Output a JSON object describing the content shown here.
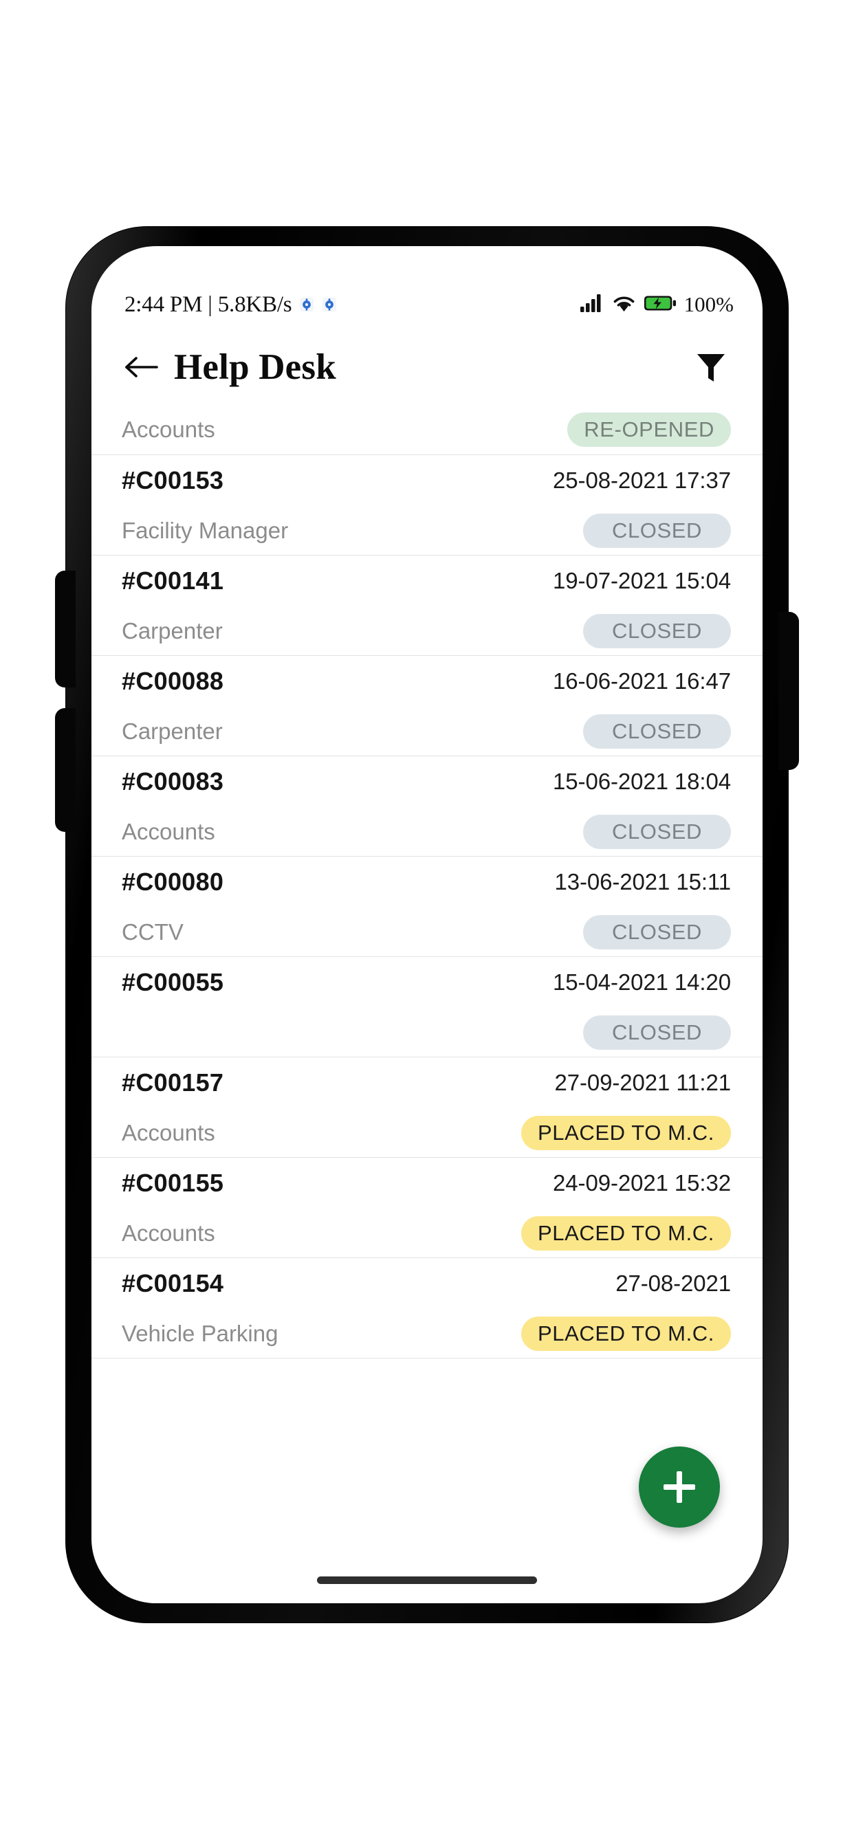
{
  "status_bar": {
    "time_and_speed": "2:44 PM | 5.8KB/s",
    "mini_icons": [
      "settings-gear-icon",
      "settings-gear-icon"
    ],
    "signal_icon": "signal-bars-icon",
    "wifi_icon": "wifi-icon",
    "battery_icon": "battery-charging-icon",
    "battery_percent": "100%"
  },
  "app_bar": {
    "back_icon": "arrow-left-icon",
    "title": "Help Desk",
    "filter_icon": "filter-funnel-icon"
  },
  "colors": {
    "fab_green": "#167d3b",
    "badge_closed_bg": "#dde4e9",
    "badge_closed_text": "#7b8288",
    "badge_reopened_bg": "#d5ead9",
    "badge_reopened_text": "#76817a",
    "badge_placed_bg": "#fce68a",
    "badge_placed_text": "#19191a"
  },
  "fab": {
    "icon": "plus-icon",
    "label": "+"
  },
  "tickets": [
    {
      "id": "",
      "date": "",
      "dept": "Accounts",
      "status": "RE-OPENED",
      "status_kind": "reopened",
      "partial": true
    },
    {
      "id": "#C00153",
      "date": "25-08-2021 17:37",
      "dept": "Facility Manager",
      "status": "CLOSED",
      "status_kind": "closed",
      "partial": false
    },
    {
      "id": "#C00141",
      "date": "19-07-2021 15:04",
      "dept": "Carpenter",
      "status": "CLOSED",
      "status_kind": "closed",
      "partial": false
    },
    {
      "id": "#C00088",
      "date": "16-06-2021 16:47",
      "dept": "Carpenter",
      "status": "CLOSED",
      "status_kind": "closed",
      "partial": false
    },
    {
      "id": "#C00083",
      "date": "15-06-2021 18:04",
      "dept": "Accounts",
      "status": "CLOSED",
      "status_kind": "closed",
      "partial": false
    },
    {
      "id": "#C00080",
      "date": "13-06-2021 15:11",
      "dept": "CCTV",
      "status": "CLOSED",
      "status_kind": "closed",
      "partial": false
    },
    {
      "id": "#C00055",
      "date": "15-04-2021 14:20",
      "dept": "",
      "status": "CLOSED",
      "status_kind": "closed",
      "partial": false
    },
    {
      "id": "#C00157",
      "date": "27-09-2021 11:21",
      "dept": "Accounts",
      "status": "PLACED TO M.C.",
      "status_kind": "placed",
      "partial": false
    },
    {
      "id": "#C00155",
      "date": "24-09-2021 15:32",
      "dept": "Accounts",
      "status": "PLACED TO M.C.",
      "status_kind": "placed",
      "partial": false
    },
    {
      "id": "#C00154",
      "date": "27-08-2021",
      "dept": "Vehicle Parking",
      "status": "PLACED TO M.C.",
      "status_kind": "placed",
      "partial": false
    }
  ]
}
